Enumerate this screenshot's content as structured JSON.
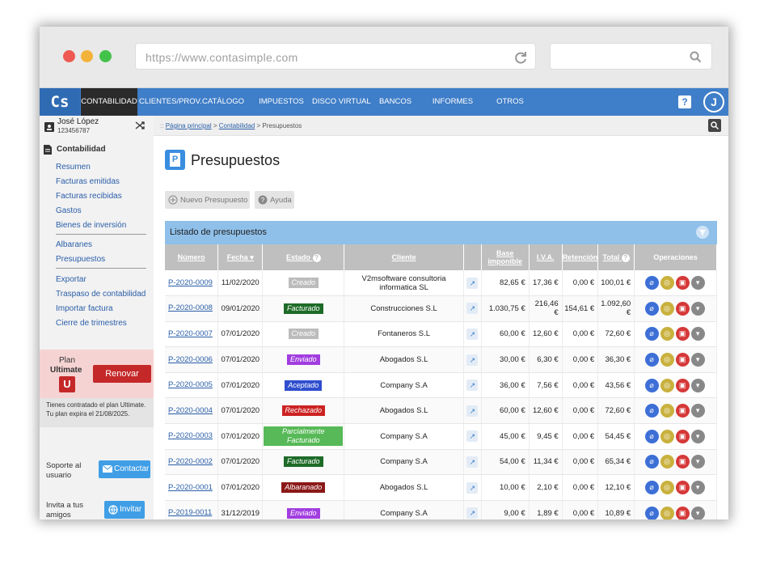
{
  "browser": {
    "url": "https://www.contasimple.com"
  },
  "app": {
    "logo": "Cs"
  },
  "nav": [
    "CONTABILIDAD",
    "CLIENTES/PROV.",
    "CATÁLOGO",
    "IMPUESTOS",
    "DISCO VIRTUAL",
    "BANCOS",
    "INFORMES",
    "OTROS"
  ],
  "user": {
    "name": "José López",
    "id": "123456787",
    "initial": "J"
  },
  "sidebar": {
    "section": "Contabilidad",
    "group1": [
      "Resumen",
      "Facturas emitidas",
      "Facturas recibidas",
      "Gastos",
      "Bienes de inversión"
    ],
    "group2": [
      "Albaranes",
      "Presupuestos"
    ],
    "group3": [
      "Exportar",
      "Traspaso de contabilidad",
      "Importar factura",
      "Cierre de trimestres"
    ],
    "plan_label": "Plan",
    "plan_name": "Ultimate",
    "plan_badge": "U",
    "renew": "Renovar",
    "plan_info": "Tienes contratado el plan Ultimate. Tu plan expira el 21/08/2025.",
    "support_label": "Soporte al usuario",
    "contact": "Contactar",
    "invite_label": "Invita a tus amigos",
    "invite": "Invitar"
  },
  "breadcrumb": {
    "home": "Página principal",
    "section": "Contabilidad",
    "current": "Presupuestos",
    "sep": ">"
  },
  "page": {
    "title": "Presupuestos",
    "icon_letter": "P",
    "new_button": "Nuevo Presupuesto",
    "help_button": "Ayuda"
  },
  "list": {
    "title": "Listado de presupuestos",
    "columns": [
      "Número",
      "Fecha",
      "Estado",
      "Cliente",
      "",
      "Base imponible",
      "I.V.A.",
      "Retención",
      "Total",
      "Operaciones"
    ],
    "rows": [
      {
        "numero": "P-2020-0009",
        "fecha": "11/02/2020",
        "estado": "Creado",
        "color": "#bcbcbc",
        "cliente": "V2msoftware consultoria informatica SL",
        "base": "82,65 €",
        "iva": "17,36 €",
        "ret": "0,00 €",
        "total": "100,01 €"
      },
      {
        "numero": "P-2020-0008",
        "fecha": "09/01/2020",
        "estado": "Facturado",
        "color": "#1e6b28",
        "cliente": "Construcciones S.L",
        "base": "1.030,75 €",
        "iva": "216,46 €",
        "ret": "154,61 €",
        "total": "1.092,60 €"
      },
      {
        "numero": "P-2020-0007",
        "fecha": "07/01/2020",
        "estado": "Creado",
        "color": "#bcbcbc",
        "cliente": "Fontaneros S.L",
        "base": "60,00 €",
        "iva": "12,60 €",
        "ret": "0,00 €",
        "total": "72,60 €"
      },
      {
        "numero": "P-2020-0006",
        "fecha": "07/01/2020",
        "estado": "Enviado",
        "color": "#a23ee0",
        "cliente": "Abogados S.L",
        "base": "30,00 €",
        "iva": "6,30 €",
        "ret": "0,00 €",
        "total": "36,30 €"
      },
      {
        "numero": "P-2020-0005",
        "fecha": "07/01/2020",
        "estado": "Aceptado",
        "color": "#2f4fcf",
        "cliente": "Company S.A",
        "base": "36,00 €",
        "iva": "7,56 €",
        "ret": "0,00 €",
        "total": "43,56 €"
      },
      {
        "numero": "P-2020-0004",
        "fecha": "07/01/2020",
        "estado": "Rechazado",
        "color": "#cc2222",
        "cliente": "Abogados S.L",
        "base": "60,00 €",
        "iva": "12,60 €",
        "ret": "0,00 €",
        "total": "72,60 €"
      },
      {
        "numero": "P-2020-0003",
        "fecha": "07/01/2020",
        "estado": "Parcialmente Facturado",
        "color": "#57b957",
        "cliente": "Company S.A",
        "base": "45,00 €",
        "iva": "9,45 €",
        "ret": "0,00 €",
        "total": "54,45 €"
      },
      {
        "numero": "P-2020-0002",
        "fecha": "07/01/2020",
        "estado": "Facturado",
        "color": "#1e6b28",
        "cliente": "Company S.A",
        "base": "54,00 €",
        "iva": "11,34 €",
        "ret": "0,00 €",
        "total": "65,34 €"
      },
      {
        "numero": "P-2020-0001",
        "fecha": "07/01/2020",
        "estado": "Albaranado",
        "color": "#8b1818",
        "cliente": "Abogados S.L",
        "base": "10,00 €",
        "iva": "2,10 €",
        "ret": "0,00 €",
        "total": "12,10 €"
      },
      {
        "numero": "P-2019-0011",
        "fecha": "31/12/2019",
        "estado": "Enviado",
        "color": "#a23ee0",
        "cliente": "Company S.A",
        "base": "9,00 €",
        "iva": "1,89 €",
        "ret": "0,00 €",
        "total": "10,89 €"
      }
    ]
  }
}
